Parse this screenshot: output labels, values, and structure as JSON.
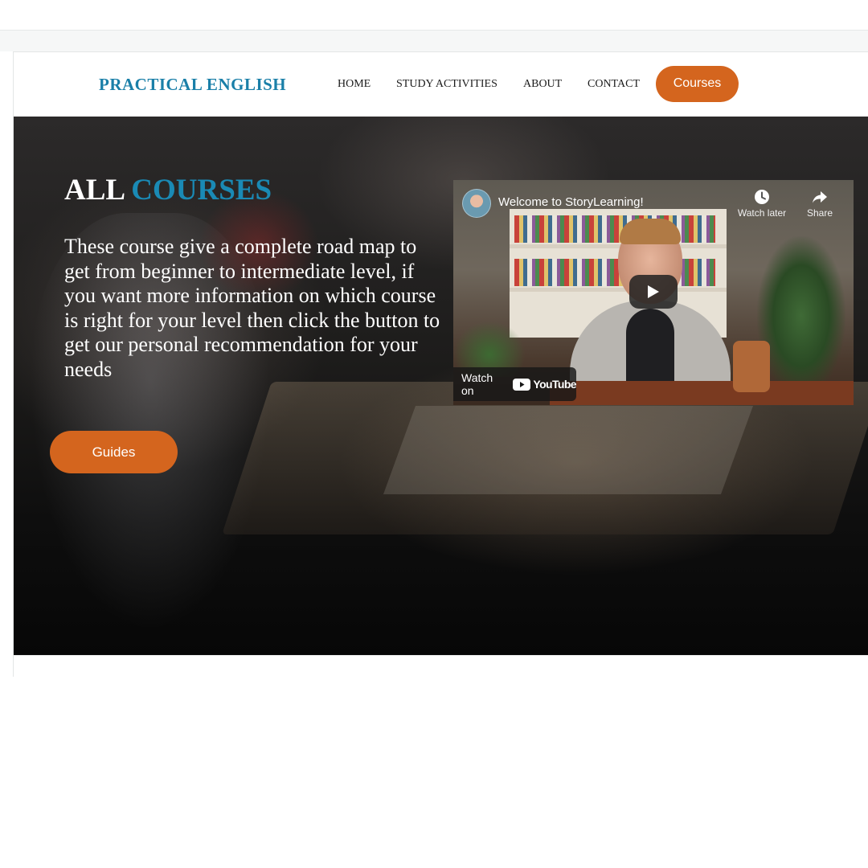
{
  "header": {
    "logo": "PRACTICAL ENGLISH",
    "nav": [
      "HOME",
      "STUDY ACTIVITIES",
      "ABOUT",
      "CONTACT"
    ],
    "cta_label": "Courses"
  },
  "hero": {
    "title_part1": "ALL",
    "title_part2": "COURSES",
    "description": "These course give a complete road map to get from beginner to intermediate level, if you want more information on which course is right for your level then click the button to get our personal recommendation for your needs",
    "button_label": "Guides"
  },
  "video": {
    "title": "Welcome to StoryLearning!",
    "watch_later_label": "Watch later",
    "share_label": "Share",
    "watch_on_label": "Watch on",
    "youtube_label": "YouTube"
  },
  "colors": {
    "accent_blue": "#1a7fa8",
    "accent_orange": "#d4651e"
  }
}
